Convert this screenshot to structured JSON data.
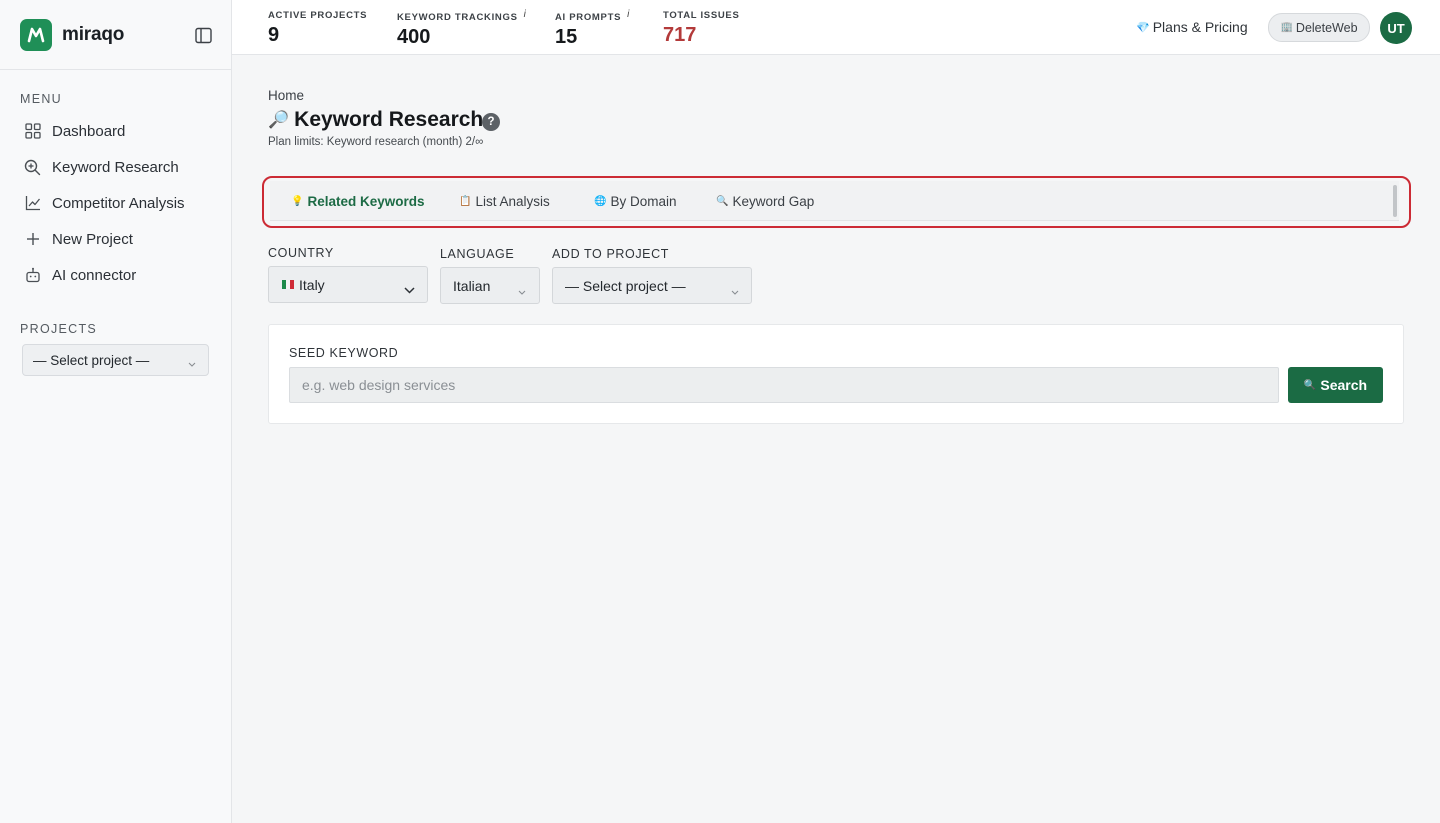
{
  "app": {
    "brand_name": "miraqo",
    "accent_color": "#1b6b44",
    "danger_color": "#b33a3a",
    "highlight_color": "#cc2b35"
  },
  "sidebar": {
    "menu_heading": "MENU",
    "items": [
      {
        "label": "Dashboard",
        "icon": "dashboard-grid-icon"
      },
      {
        "label": "Keyword Research",
        "icon": "search-plus-icon"
      },
      {
        "label": "Competitor Analysis",
        "icon": "line-chart-icon"
      },
      {
        "label": "New Project",
        "icon": "plus-icon"
      },
      {
        "label": "AI connector",
        "icon": "robot-icon"
      }
    ],
    "projects_heading": "PROJECTS",
    "project_select": "— Select project —"
  },
  "topbar": {
    "stats": [
      {
        "label": "ACTIVE PROJECTS",
        "value": "9",
        "info": ""
      },
      {
        "label": "KEYWORD TRACKINGS",
        "value": "400",
        "info": "i"
      },
      {
        "label": "AI PROMPTS",
        "value": "15",
        "info": "i"
      },
      {
        "label": "TOTAL ISSUES",
        "value": "717",
        "info": ""
      }
    ],
    "plans_label": "Plans & Pricing",
    "site_label": "DeleteWeb",
    "avatar_initials": "UT"
  },
  "page": {
    "breadcrumb": "Home",
    "title": "Keyword Research",
    "help": "?",
    "plan_limits": "Plan limits: Keyword research (month) 2/∞"
  },
  "tabs": [
    {
      "label": "Related Keywords",
      "icon": "lightbulb-icon",
      "glyph": "💡",
      "active": true
    },
    {
      "label": "List Analysis",
      "icon": "clipboard-icon",
      "glyph": "📋",
      "active": false
    },
    {
      "label": "By Domain",
      "icon": "globe-icon",
      "glyph": "🌐",
      "active": false
    },
    {
      "label": "Keyword Gap",
      "icon": "magnifier-icon",
      "glyph": "🔍",
      "active": false
    }
  ],
  "filters": {
    "country_label": "COUNTRY",
    "country_value": "Italy",
    "language_label": "LANGUAGE",
    "language_value": "Italian",
    "project_label": "ADD TO PROJECT",
    "project_value": "— Select project —"
  },
  "seed": {
    "label": "SEED KEYWORD",
    "placeholder": "e.g. web design services",
    "value": "",
    "button_label": "Search"
  }
}
